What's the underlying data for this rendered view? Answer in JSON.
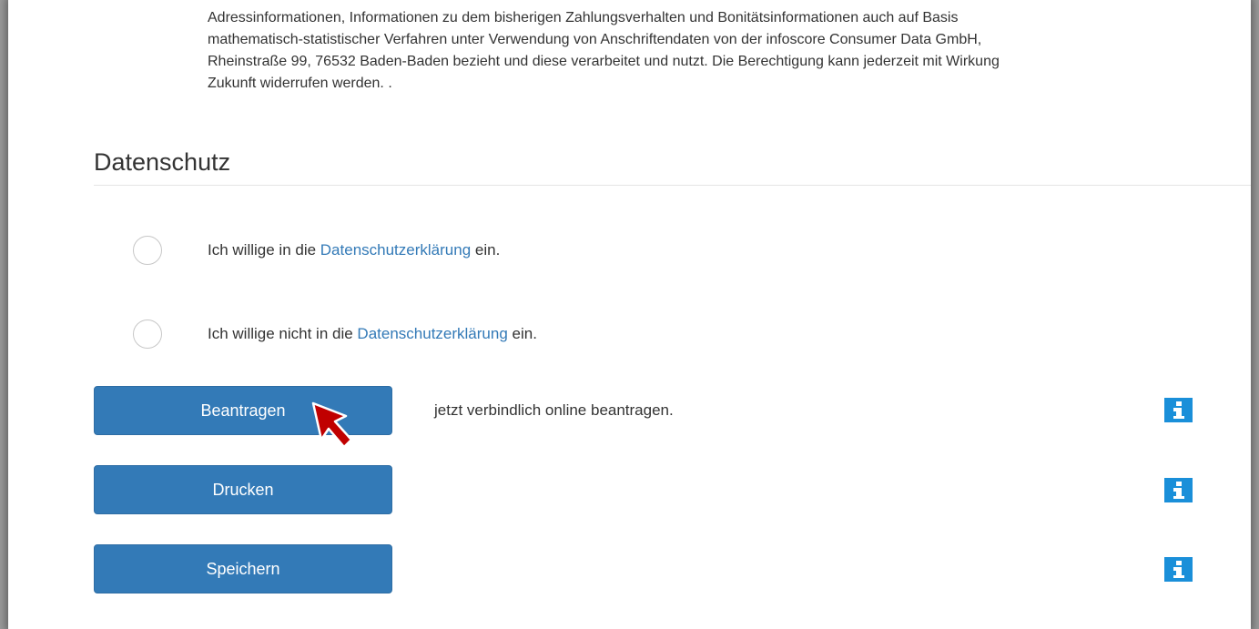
{
  "intro": {
    "lines": [
      "Adressinformationen, Informationen zu dem bisherigen Zahlungsverhalten und Bonitätsinformationen auch auf Basis",
      "mathematisch-statistischer Verfahren unter Verwendung von Anschriftendaten von der infoscore Consumer Data GmbH,",
      "Rheinstraße 99, 76532 Baden-Baden bezieht und diese verarbeitet und nutzt. Die Berechtigung kann jederzeit mit Wirkung",
      "Zukunft widerrufen werden. ."
    ]
  },
  "section": {
    "title": "Datenschutz"
  },
  "consent": {
    "accept": {
      "prefix": "Ich willige in die ",
      "link": "Datenschutzerklärung",
      "suffix": " ein."
    },
    "decline": {
      "prefix": "Ich willige nicht in die ",
      "link": "Datenschutzerklärung",
      "suffix": " ein."
    }
  },
  "actions": {
    "apply_label": "Beantragen",
    "apply_desc": "jetzt verbindlich online beantragen.",
    "print_label": "Drucken",
    "save_label": "Speichern"
  },
  "colors": {
    "button": "#337ab7",
    "link": "#337ab7",
    "info_icon": "#1a8fd9",
    "cursor": "#c00000"
  },
  "icons": {
    "info": "info-icon",
    "cursor": "mouse-pointer-icon"
  }
}
